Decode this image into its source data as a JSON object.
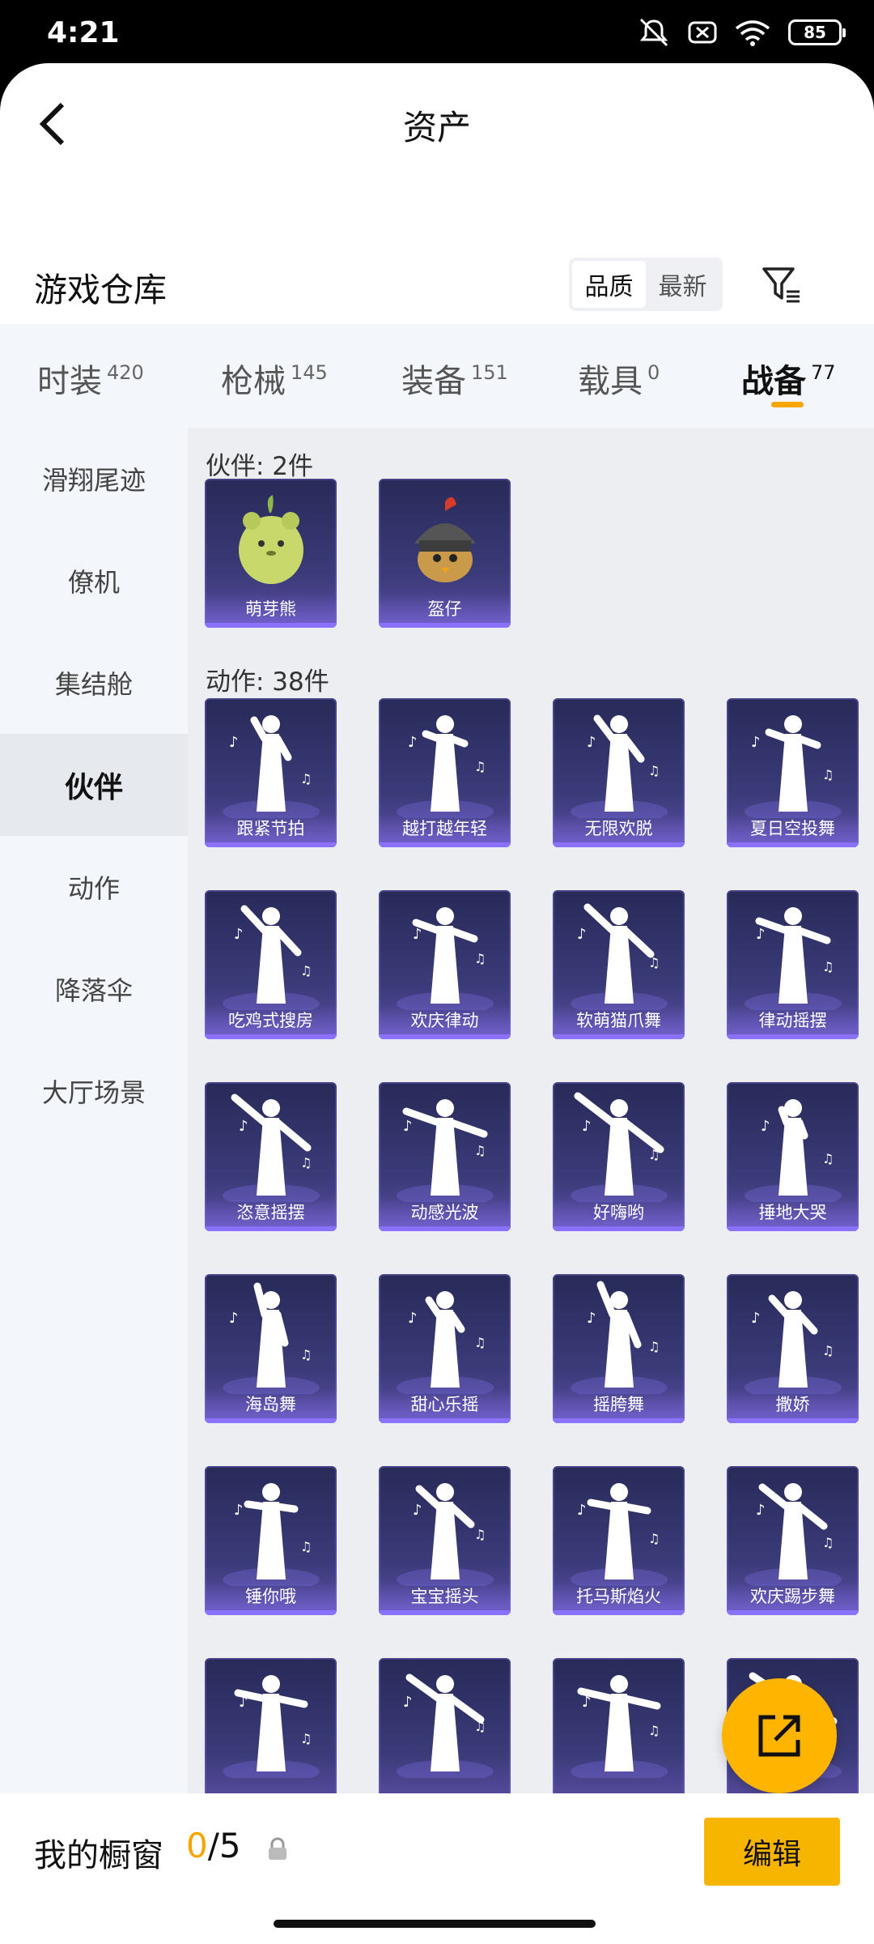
{
  "status": {
    "time": "4:21",
    "battery": "85"
  },
  "header": {
    "title": "资产"
  },
  "store": {
    "title": "游戏仓库",
    "sort_options": [
      "品质",
      "最新"
    ],
    "sort_active": "品质"
  },
  "tabs": [
    {
      "label": "时装",
      "count": "420"
    },
    {
      "label": "枪械",
      "count": "145"
    },
    {
      "label": "装备",
      "count": "151"
    },
    {
      "label": "载具",
      "count": "0"
    },
    {
      "label": "战备",
      "count": "77",
      "active": true
    }
  ],
  "sidebar": [
    "滑翔尾迹",
    "僚机",
    "集结舱",
    "伙伴",
    "动作",
    "降落伞",
    "大厅场景"
  ],
  "sidebar_active": "伙伴",
  "sections": {
    "partners": {
      "title": "伙伴: 2件",
      "items": [
        "萌芽熊",
        "盔仔"
      ]
    },
    "emotes": {
      "title": "动作: 38件",
      "items": [
        "跟紧节拍",
        "越打越年轻",
        "无限欢脱",
        "夏日空投舞",
        "吃鸡式搜房",
        "欢庆律动",
        "软萌猫爪舞",
        "律动摇摆",
        "恣意摇摆",
        "动感光波",
        "好嗨哟",
        "捶地大哭",
        "海岛舞",
        "甜心乐摇",
        "摇胯舞",
        "撒娇",
        "锤你哦",
        "宝宝摇头",
        "托马斯焰火",
        "欢庆踢步舞",
        "",
        "",
        "",
        ""
      ]
    }
  },
  "footer": {
    "label": "我的橱窗",
    "count_current": "0",
    "count_sep_total": "/5",
    "edit_label": "编辑"
  },
  "colors": {
    "accent": "#f7a600",
    "card_bg": "#2d2c62",
    "fab": "#ffb400"
  }
}
